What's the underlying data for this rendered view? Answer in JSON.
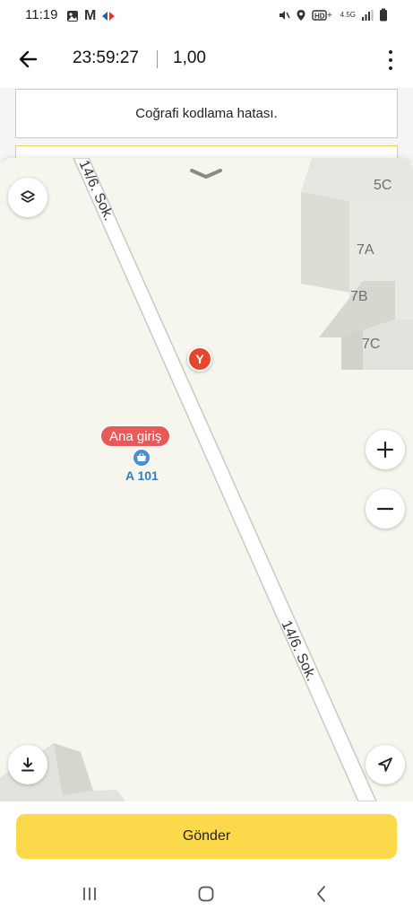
{
  "status_bar": {
    "time": "11:19",
    "network": "4.5G",
    "left_icons": [
      "gallery-icon",
      "m-app-icon",
      "carrefour-icon"
    ],
    "right_icons": [
      "mute-icon",
      "location-icon",
      "hd-voice-icon",
      "network-4.5g-icon",
      "signal-icon",
      "battery-icon"
    ]
  },
  "header": {
    "time": "23:59:27",
    "value": "1,00",
    "back_icon": "arrow-left-icon",
    "menu_icon": "more-vertical-icon"
  },
  "error": {
    "message": "Coğrafi kodlama hatası."
  },
  "map": {
    "building_labels": [
      "5C",
      "7A",
      "7B",
      "7C"
    ],
    "street_name": "14/6. Sok.",
    "poi_marker_letter": "Y",
    "entrance_label": "Ana giriş",
    "shop_name": "A 101",
    "controls": {
      "layers_icon": "layers-icon",
      "zoom_in": "+",
      "zoom_out": "−",
      "download_icon": "download-icon",
      "locate_icon": "navigation-arrow-icon"
    }
  },
  "actions": {
    "send_label": "Gönder"
  },
  "nav_bar": {
    "items": [
      "recent-apps-icon",
      "home-icon",
      "back-icon"
    ]
  },
  "colors": {
    "accent_yellow": "#fcd94b",
    "error_border": "#e8d45a",
    "map_background": "#f6f6ef",
    "marker_red": "#e8452d",
    "shop_blue": "#2e7fc1"
  }
}
